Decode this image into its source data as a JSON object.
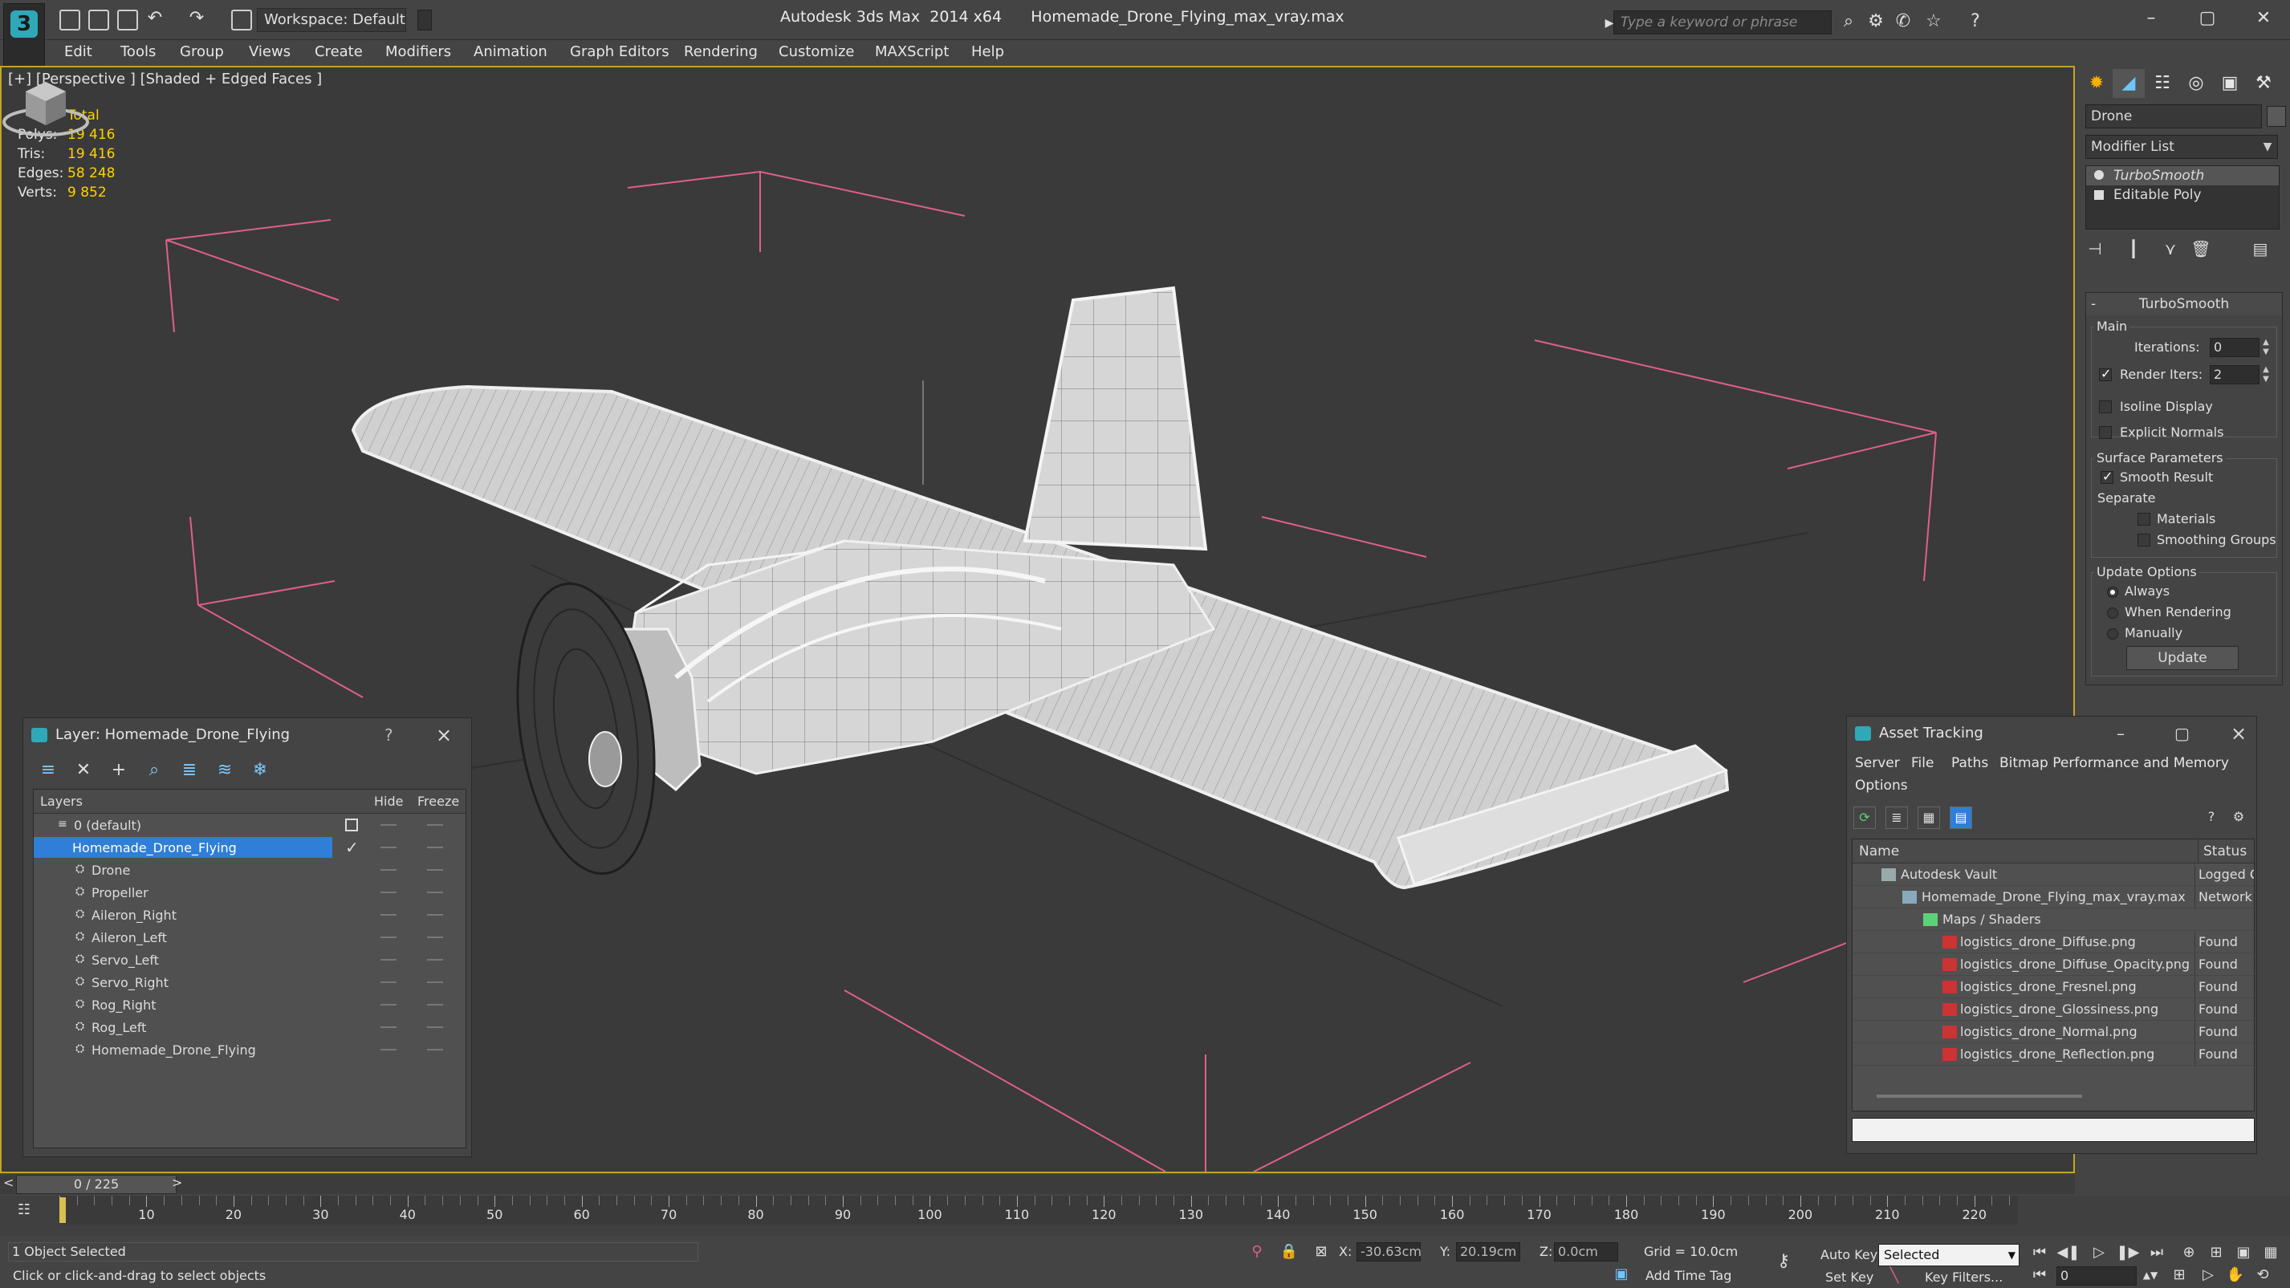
{
  "title_bar": {
    "workspace": "Workspace: Default",
    "app_title": "Autodesk 3ds Max  2014 x64      Homemade_Drone_Flying_max_vray.max",
    "search_placeholder": "Type a keyword or phrase"
  },
  "menu": [
    "Edit",
    "Tools",
    "Group",
    "Views",
    "Create",
    "Modifiers",
    "Animation",
    "Graph Editors",
    "Rendering",
    "Customize",
    "MAXScript",
    "Help"
  ],
  "viewport": {
    "label": "[+] [Perspective ] [Shaded + Edged Faces ]",
    "stats": {
      "header": "Total",
      "rows": [
        {
          "k": "Polys:",
          "v": "19 416"
        },
        {
          "k": "Tris:",
          "v": "19 416"
        },
        {
          "k": "Edges:",
          "v": "58 248"
        },
        {
          "k": "Verts:",
          "v": "9 852"
        }
      ]
    }
  },
  "command_panel": {
    "object_name": "Drone",
    "modifier_list": "Modifier List",
    "stack": [
      "TurboSmooth",
      "Editable Poly"
    ],
    "rollout_title": "TurboSmooth",
    "main_group": "Main",
    "iterations_label": "Iterations:",
    "iterations_value": "0",
    "render_iters_label": "Render Iters:",
    "render_iters_value": "2",
    "isoline": "Isoline Display",
    "explicit_normals": "Explicit Normals",
    "surface_group": "Surface Parameters",
    "smooth_result": "Smooth Result",
    "separate": "Separate",
    "materials": "Materials",
    "smoothing_groups": "Smoothing Groups",
    "update_group": "Update Options",
    "always": "Always",
    "when_rendering": "When Rendering",
    "manually": "Manually",
    "update_button": "Update"
  },
  "layer_dialog": {
    "title": "Layer: Homemade_Drone_Flying",
    "help": "?",
    "col_layers": "Layers",
    "col_hide": "Hide",
    "col_freeze": "Freeze",
    "rows": [
      {
        "name": "0 (default)",
        "level": 0
      },
      {
        "name": "Homemade_Drone_Flying",
        "level": 0
      },
      {
        "name": "Drone",
        "level": 1
      },
      {
        "name": "Propeller",
        "level": 1
      },
      {
        "name": "Aileron_Right",
        "level": 1
      },
      {
        "name": "Aileron_Left",
        "level": 1
      },
      {
        "name": "Servo_Left",
        "level": 1
      },
      {
        "name": "Servo_Right",
        "level": 1
      },
      {
        "name": "Rog_Right",
        "level": 1
      },
      {
        "name": "Rog_Left",
        "level": 1
      },
      {
        "name": "Homemade_Drone_Flying",
        "level": 1
      }
    ]
  },
  "asset_dialog": {
    "title": "Asset Tracking",
    "menu": [
      "Server",
      "File",
      "Paths",
      "Bitmap Performance and Memory",
      "Options"
    ],
    "col_name": "Name",
    "col_status": "Status",
    "rows": [
      {
        "name": "Autodesk Vault",
        "status": "Logged O",
        "level": 0
      },
      {
        "name": "Homemade_Drone_Flying_max_vray.max",
        "status": "Network",
        "level": 1
      },
      {
        "name": "Maps / Shaders",
        "status": "",
        "level": 2
      },
      {
        "name": "logistics_drone_Diffuse.png",
        "status": "Found",
        "level": 3
      },
      {
        "name": "logistics_drone_Diffuse_Opacity.png",
        "status": "Found",
        "level": 3
      },
      {
        "name": "logistics_drone_Fresnel.png",
        "status": "Found",
        "level": 3
      },
      {
        "name": "logistics_drone_Glossiness.png",
        "status": "Found",
        "level": 3
      },
      {
        "name": "logistics_drone_Normal.png",
        "status": "Found",
        "level": 3
      },
      {
        "name": "logistics_drone_Reflection.png",
        "status": "Found",
        "level": 3
      }
    ]
  },
  "timeline": {
    "frame_readout": "0 / 225",
    "tick_labels": [
      "10",
      "20",
      "30",
      "40",
      "50",
      "60",
      "70",
      "80",
      "90",
      "100",
      "110",
      "120",
      "130",
      "140",
      "150",
      "160",
      "170",
      "180",
      "190",
      "200",
      "210",
      "220"
    ],
    "current_frame": 0,
    "total_frames": 225
  },
  "status_bar": {
    "selection": "1 Object Selected",
    "prompt": "Click or click-and-drag to select objects",
    "x_label": "X:",
    "x_value": "-30.63cm",
    "y_label": "Y:",
    "y_value": "20.19cm",
    "z_label": "Z:",
    "z_value": "0.0cm",
    "grid": "Grid = 10.0cm",
    "add_time_tag": "Add Time Tag",
    "auto_key": "Auto Key",
    "set_key": "Set Key",
    "selected": "Selected",
    "key_filters": "Key Filters...",
    "frame_value": "0"
  },
  "colors": {
    "selection_blue": "#2f7ed8",
    "stats_yellow": "#ffd200",
    "viewport_border": "#c6a227",
    "light_pink": "#e05f8a"
  }
}
